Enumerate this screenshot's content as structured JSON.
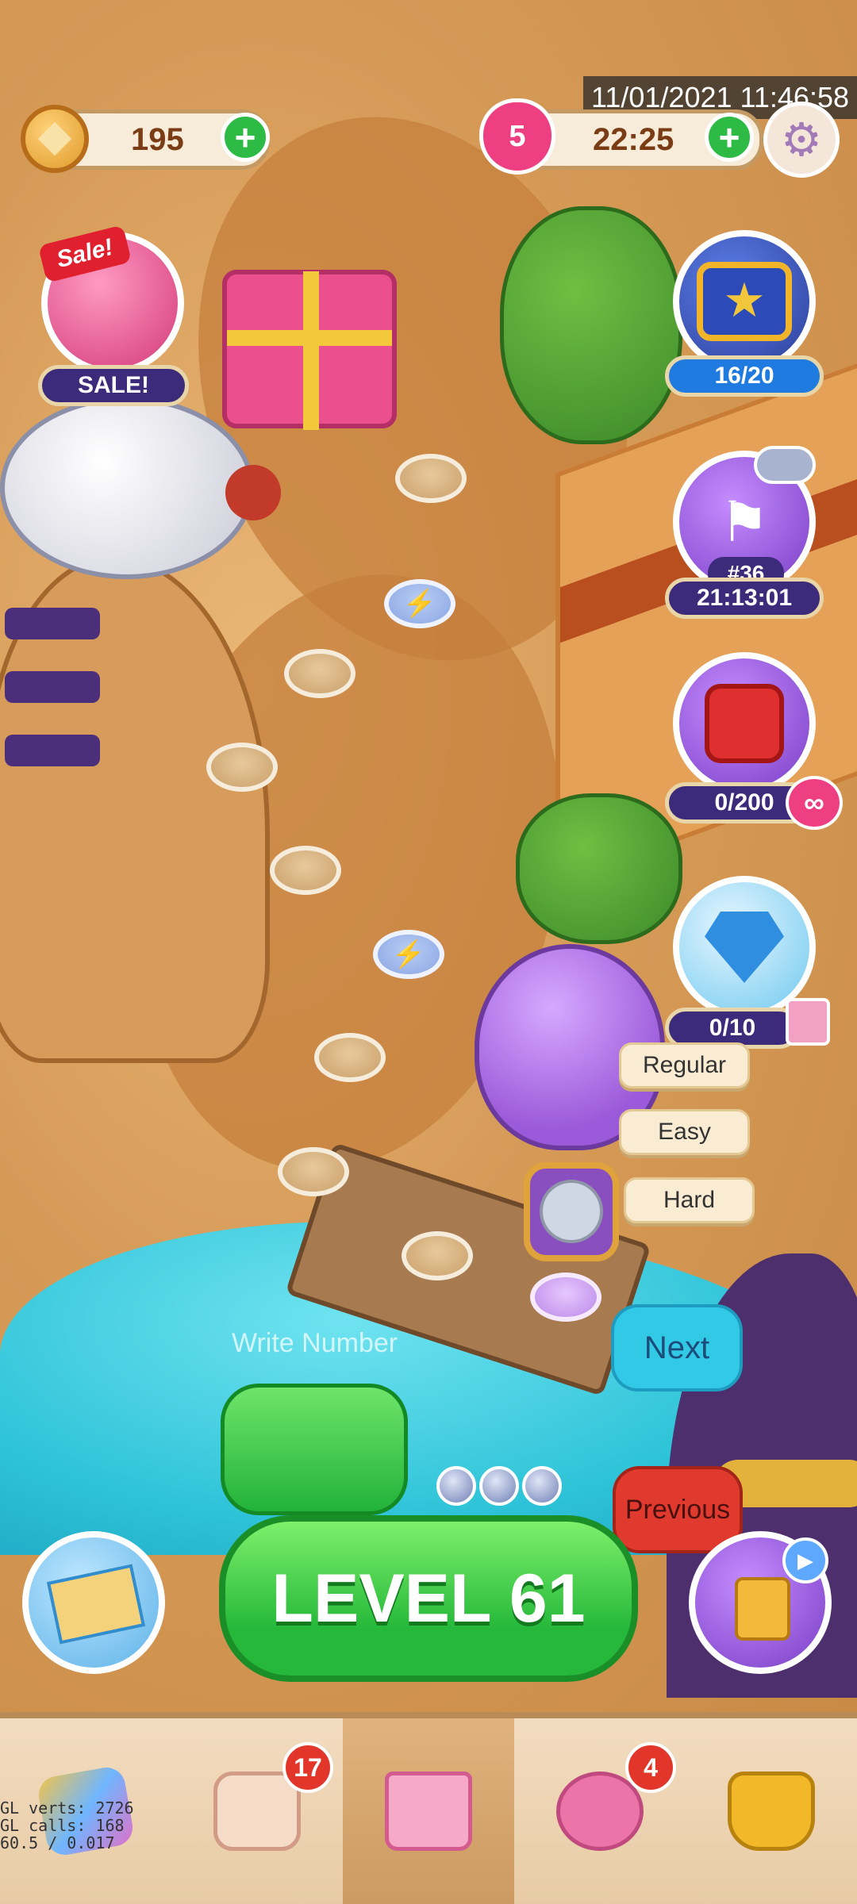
{
  "hud": {
    "timestamp": "11/01/2021 11:46:58",
    "coins": "195",
    "lives": "5",
    "life_timer": "22:25"
  },
  "sale": {
    "ribbon": "Sale!",
    "label": "SALE!"
  },
  "events": {
    "star_chest_progress": "16/20",
    "race_rank": "#36",
    "race_timer": "21:13:01",
    "block_progress": "0/200",
    "gem_progress": "0/10"
  },
  "path_nodes": {
    "special_symbol": "⚡"
  },
  "difficulty": {
    "regular": "Regular",
    "easy": "Easy",
    "hard": "Hard"
  },
  "controls": {
    "write_number_placeholder": "Write Number",
    "next": "Next",
    "previous": "Previous",
    "level_button": "LEVEL 61"
  },
  "bottom_nav": {
    "mail_badge": "17",
    "team_badge": "4"
  },
  "debug": {
    "line1": "GL verts: 2726",
    "line2": "GL calls: 168",
    "line3": "60.5 / 0.017"
  },
  "colors": {
    "accent_green": "#2dbb46",
    "next_blue": "#32c9e6",
    "previous_red": "#e03a2e",
    "badge_red": "#e2362a"
  }
}
